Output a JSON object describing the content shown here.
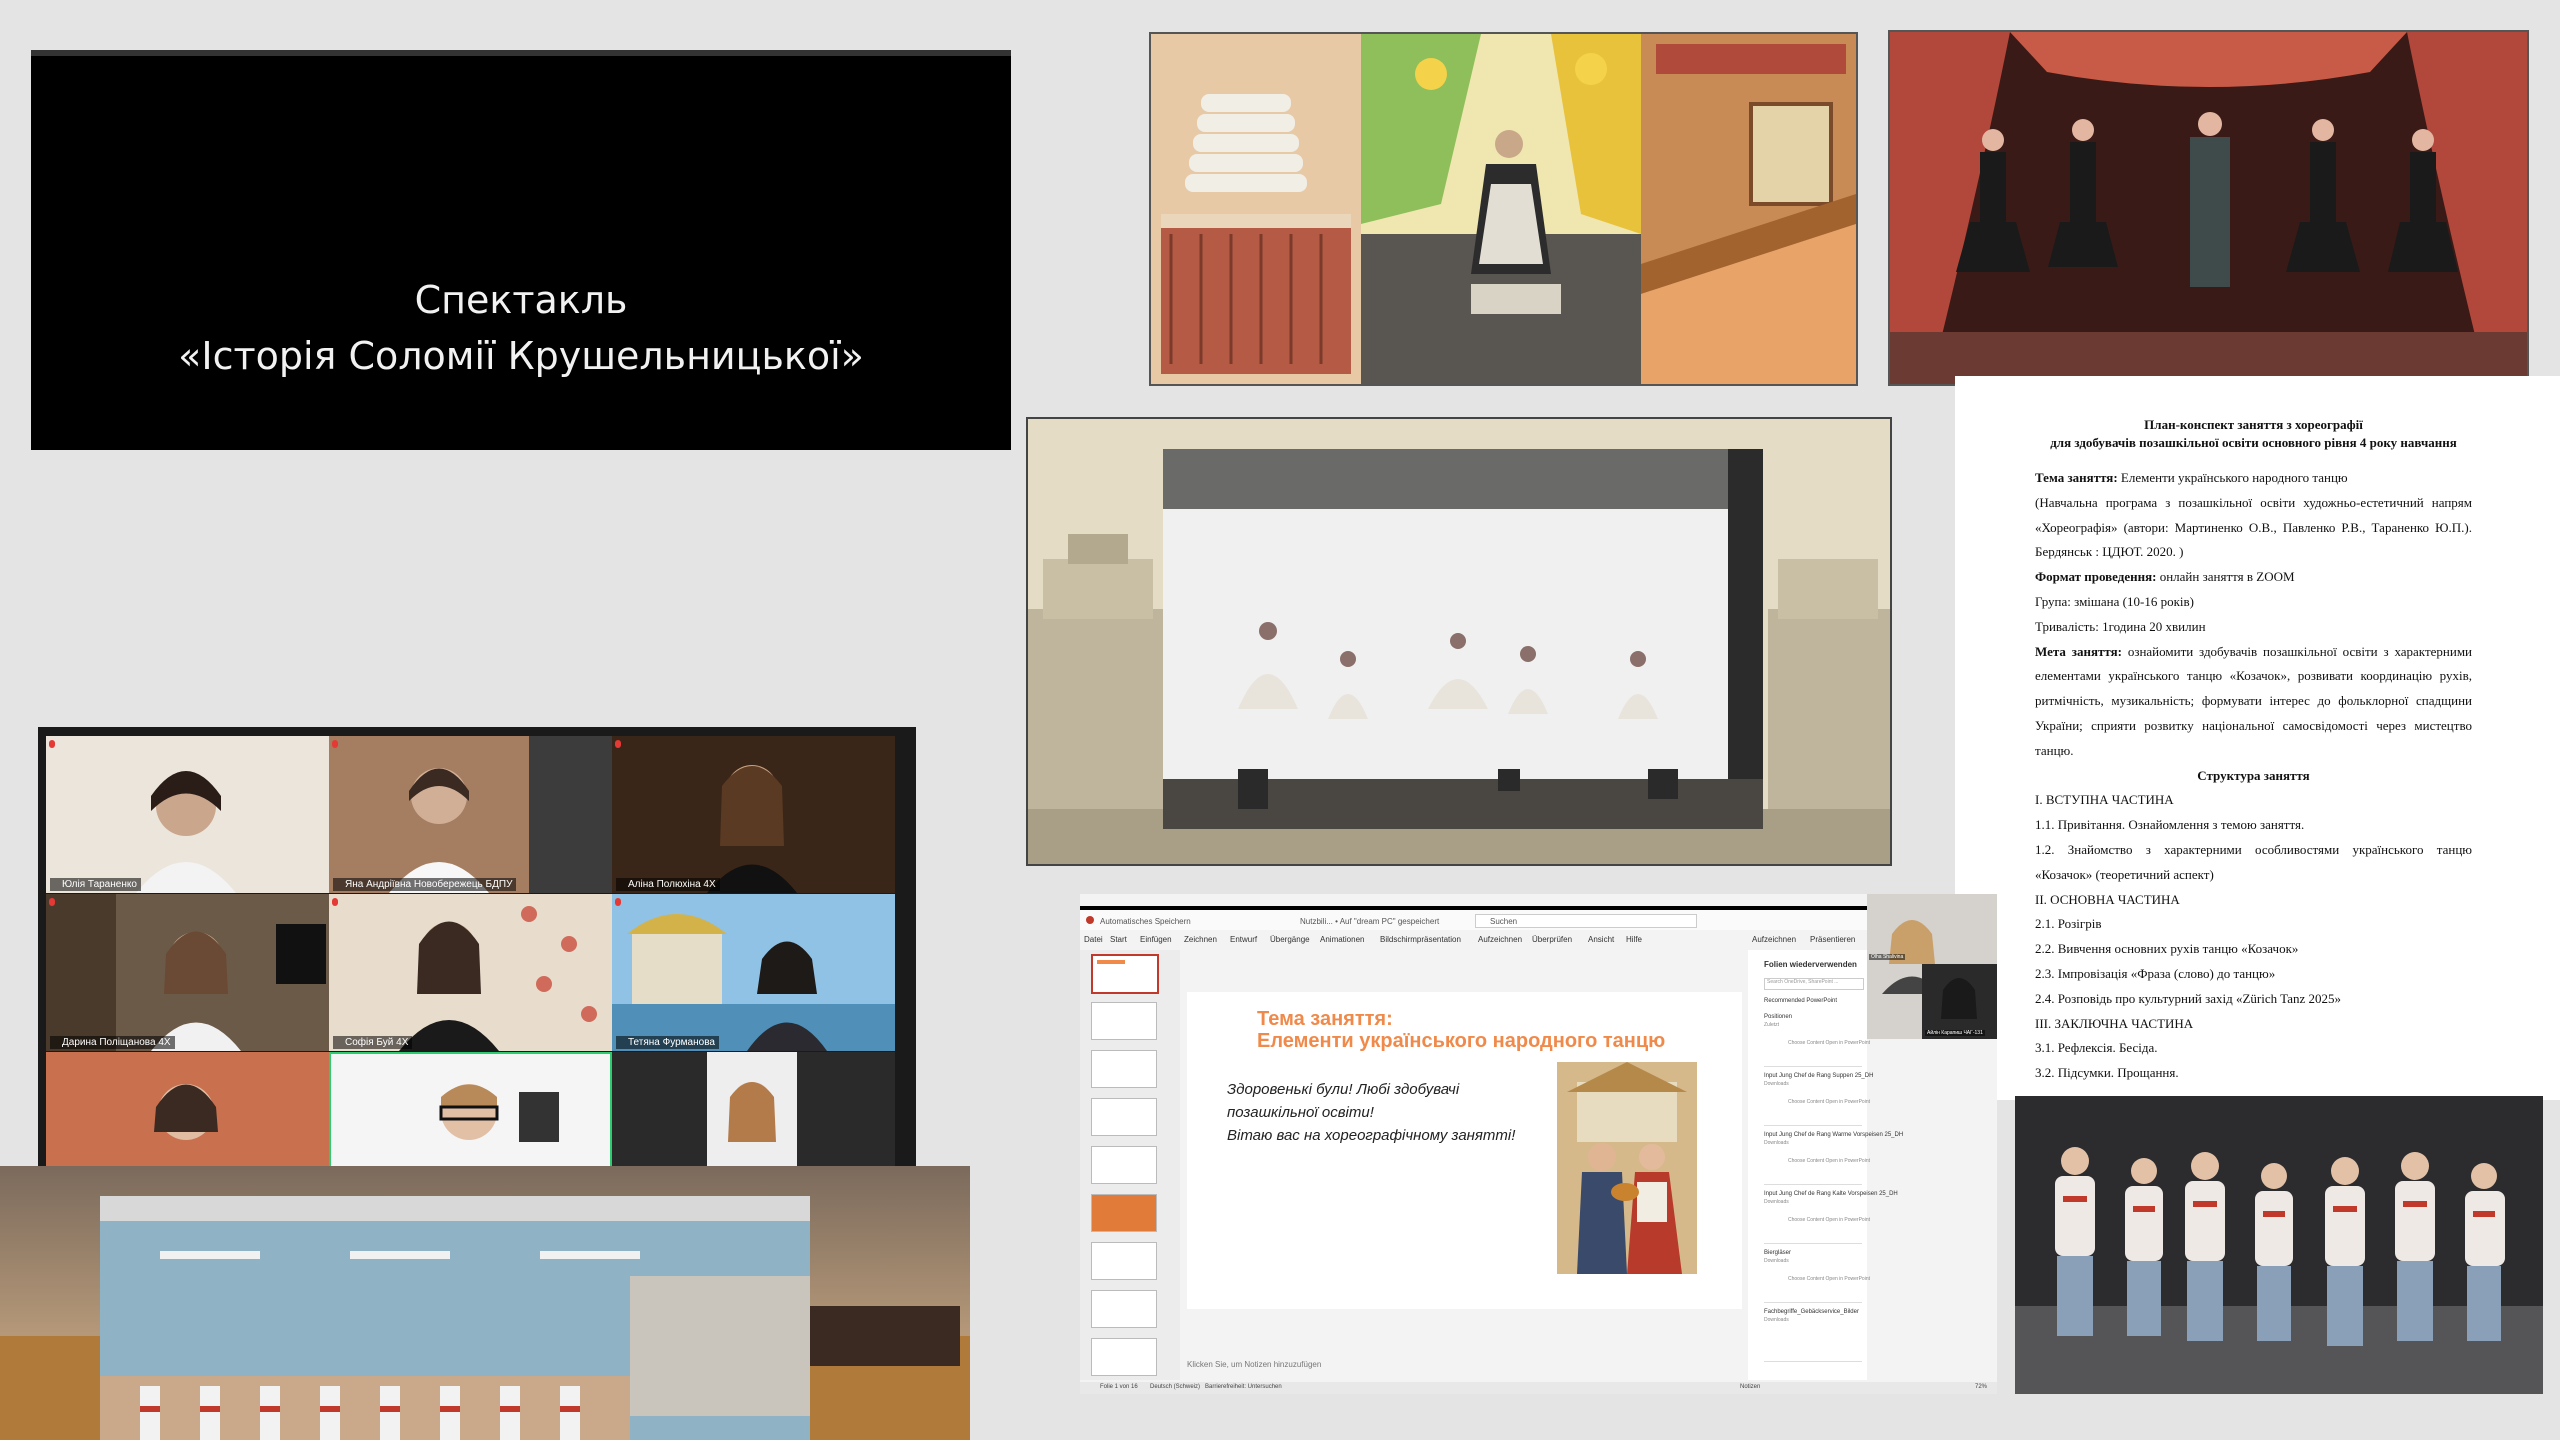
{
  "title_slide": {
    "line1": "Спектакль",
    "line2": "«Історія Соломії Крушельницької»"
  },
  "plan": {
    "title_line1": "План-конспект заняття з хореографії",
    "title_line2": "для здобувачів позашкільної освіти основного рівня 4 року навчання",
    "topic_label": "Тема заняття:",
    "topic_value": "Елементи українського народного танцю",
    "program": "(Навчальна програма з позашкільної освіти художньо-естетичний напрям «Хореографія» (автори: Мартиненко О.В., Павленко Р.В., Тараненко Ю.П.). Бердянськ : ЦДЮТ. 2020. )",
    "format_label": "Формат проведення:",
    "format_value": "онлайн заняття в ZOOM",
    "group": "Група: змішана (10-16 років)",
    "duration": "Тривалість: 1година 20 хвилин",
    "goal_label": "Мета заняття:",
    "goal_value": "ознайомити здобувачів позашкільної освіти з характерними елементами українського танцю «Козачок», розвивати координацію рухів, ритмічність, музикальність; формувати інтерес до фольклорної спадщини України; сприяти розвитку національної самосвідомості через мистецтво танцю.",
    "structure_title": "Структура заняття",
    "items": [
      "I. ВСТУПНА ЧАСТИНА",
      "1.1. Привітання. Ознайомлення з темою заняття.",
      "1.2. Знайомство з характерними особливостями українського танцю «Козачок» (теоретичний аспект)",
      "II. ОСНОВНА ЧАСТИНА",
      "2.1. Розігрів",
      "2.2. Вивчення основних рухів танцю «Козачок»",
      "2.3. Імпровізація «Фраза (слово) до танцю»",
      "2.4. Розповідь про культурний захід «Zürich Tanz 2025»",
      "III. ЗАКЛЮЧНА ЧАСТИНА",
      "3.1. Рефлексія. Бесіда.",
      "3.2. Підсумки. Прощання."
    ]
  },
  "zoom": {
    "participants": [
      {
        "name": "Юлія Тараненко"
      },
      {
        "name": "Яна Андріївна Новобережець БДПУ"
      },
      {
        "name": "Аліна Полюхіна 4Х"
      },
      {
        "name": "Дарина Поліщанова 4Х"
      },
      {
        "name": "Софія Буй 4Х"
      },
      {
        "name": "Тетяна Фурманова"
      }
    ]
  },
  "slides_app": {
    "titlebar": {
      "autosave": "Automatisches Speichern",
      "doc": "Nutzbili... • Auf \"dream PC\" gespeichert",
      "search": "Suchen"
    },
    "menu": [
      "Datei",
      "Start",
      "Einfügen",
      "Zeichnen",
      "Entwurf",
      "Übergänge",
      "Animationen",
      "Bildschirmpräsentation",
      "Aufzeichnen",
      "Überprüfen",
      "Ansicht",
      "Hilfe"
    ],
    "menu_right": [
      "Aufzeichnen",
      "Präsentieren"
    ],
    "slide_title_line1": "Тема заняття:",
    "slide_title_line2": "Елементи українського народного танцю",
    "slide_text_line1": "Здоровенькі були! Любі здобувачі",
    "slide_text_line2": "позашкільної освіти!",
    "slide_text_line3": "Вітаю вас на хореографічному занятті!",
    "notes": "Klicken Sie, um Notizen hinzuzufügen",
    "right_panel": {
      "header": "Folien wiederverwenden",
      "search": "Search OneDrive, SharePoint ...",
      "sub": "Recommended PowerPoint",
      "items": [
        {
          "title": "Positionen",
          "sub": "Zuletzt",
          "actions": "Choose Content    Open in PowerPoint"
        },
        {
          "title": "Input Jung Chef de Rang Suppen 25_DH",
          "sub": "Downloads",
          "actions": "Choose Content    Open in PowerPoint"
        },
        {
          "title": "Input Jung Chef de Rang Warme Vorspeisen 25_DH",
          "sub": "Downloads",
          "actions": "Choose Content    Open in PowerPoint"
        },
        {
          "title": "Input Jung Chef de Rang Kalte Vorspeisen 25_DH",
          "sub": "Downloads",
          "actions": "Choose Content    Open in PowerPoint"
        },
        {
          "title": "Biergläser",
          "sub": "Downloads",
          "actions": "Choose Content    Open in PowerPoint"
        },
        {
          "title": "Fachbegriffe_Gebäckservice_Bilder",
          "sub": "Downloads",
          "actions": ""
        }
      ]
    },
    "status_left": "Folie 1 von 16",
    "status_lang": "Deutsch (Schweiz)",
    "status_access": "Barrierefreiheit: Untersuchen",
    "status_notes": "Notizen",
    "status_zoom": "72%",
    "camera": {
      "name1": "Olha Shalivina",
      "name2": "Айлін Карапиш ЧАГ-131"
    }
  }
}
